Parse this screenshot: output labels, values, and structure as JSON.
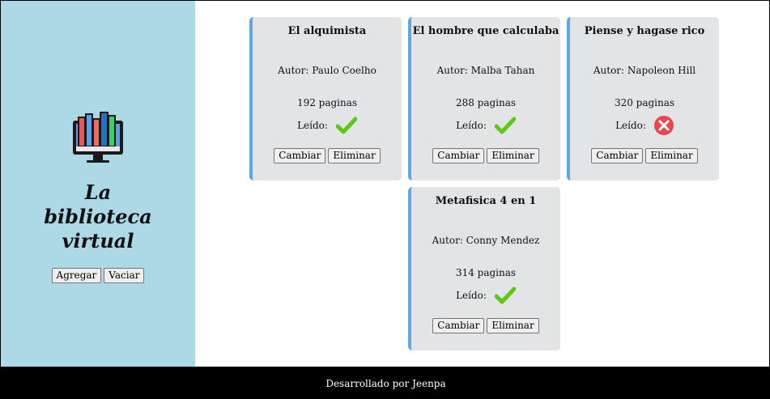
{
  "sidebar": {
    "title": "La biblioteca virtual",
    "add_label": "Agregar",
    "clear_label": "Vaciar"
  },
  "books": [
    {
      "title": "El alquimista",
      "author": "Autor: Paulo Coelho",
      "pages": "192 paginas",
      "read_label": "Leído:",
      "read": true,
      "change_label": "Cambiar",
      "delete_label": "Eliminar"
    },
    {
      "title": "El hombre que calculaba",
      "author": "Autor: Malba Tahan",
      "pages": "288 paginas",
      "read_label": "Leído:",
      "read": true,
      "change_label": "Cambiar",
      "delete_label": "Eliminar"
    },
    {
      "title": "Piense y hagase rico",
      "author": "Autor: Napoleon Hill",
      "pages": "320 paginas",
      "read_label": "Leído:",
      "read": false,
      "change_label": "Cambiar",
      "delete_label": "Eliminar"
    },
    {
      "title": "Metafisica 4 en 1",
      "author": "Autor: Conny Mendez",
      "pages": "314 paginas",
      "read_label": "Leído:",
      "read": true,
      "change_label": "Cambiar",
      "delete_label": "Eliminar"
    }
  ],
  "icons": {
    "logo": "computer-library-icon",
    "read_yes": "checkmark-icon",
    "read_no": "red-x-circle-icon"
  },
  "colors": {
    "sidebar_bg": "#add8e6",
    "card_bg": "#e2e4e6",
    "card_accent": "#5aa8e6",
    "check": "#5fc814",
    "cross": "#e8464e",
    "footer_bg": "#000000"
  },
  "footer": {
    "text": "Desarrollado por Jeenpa"
  }
}
